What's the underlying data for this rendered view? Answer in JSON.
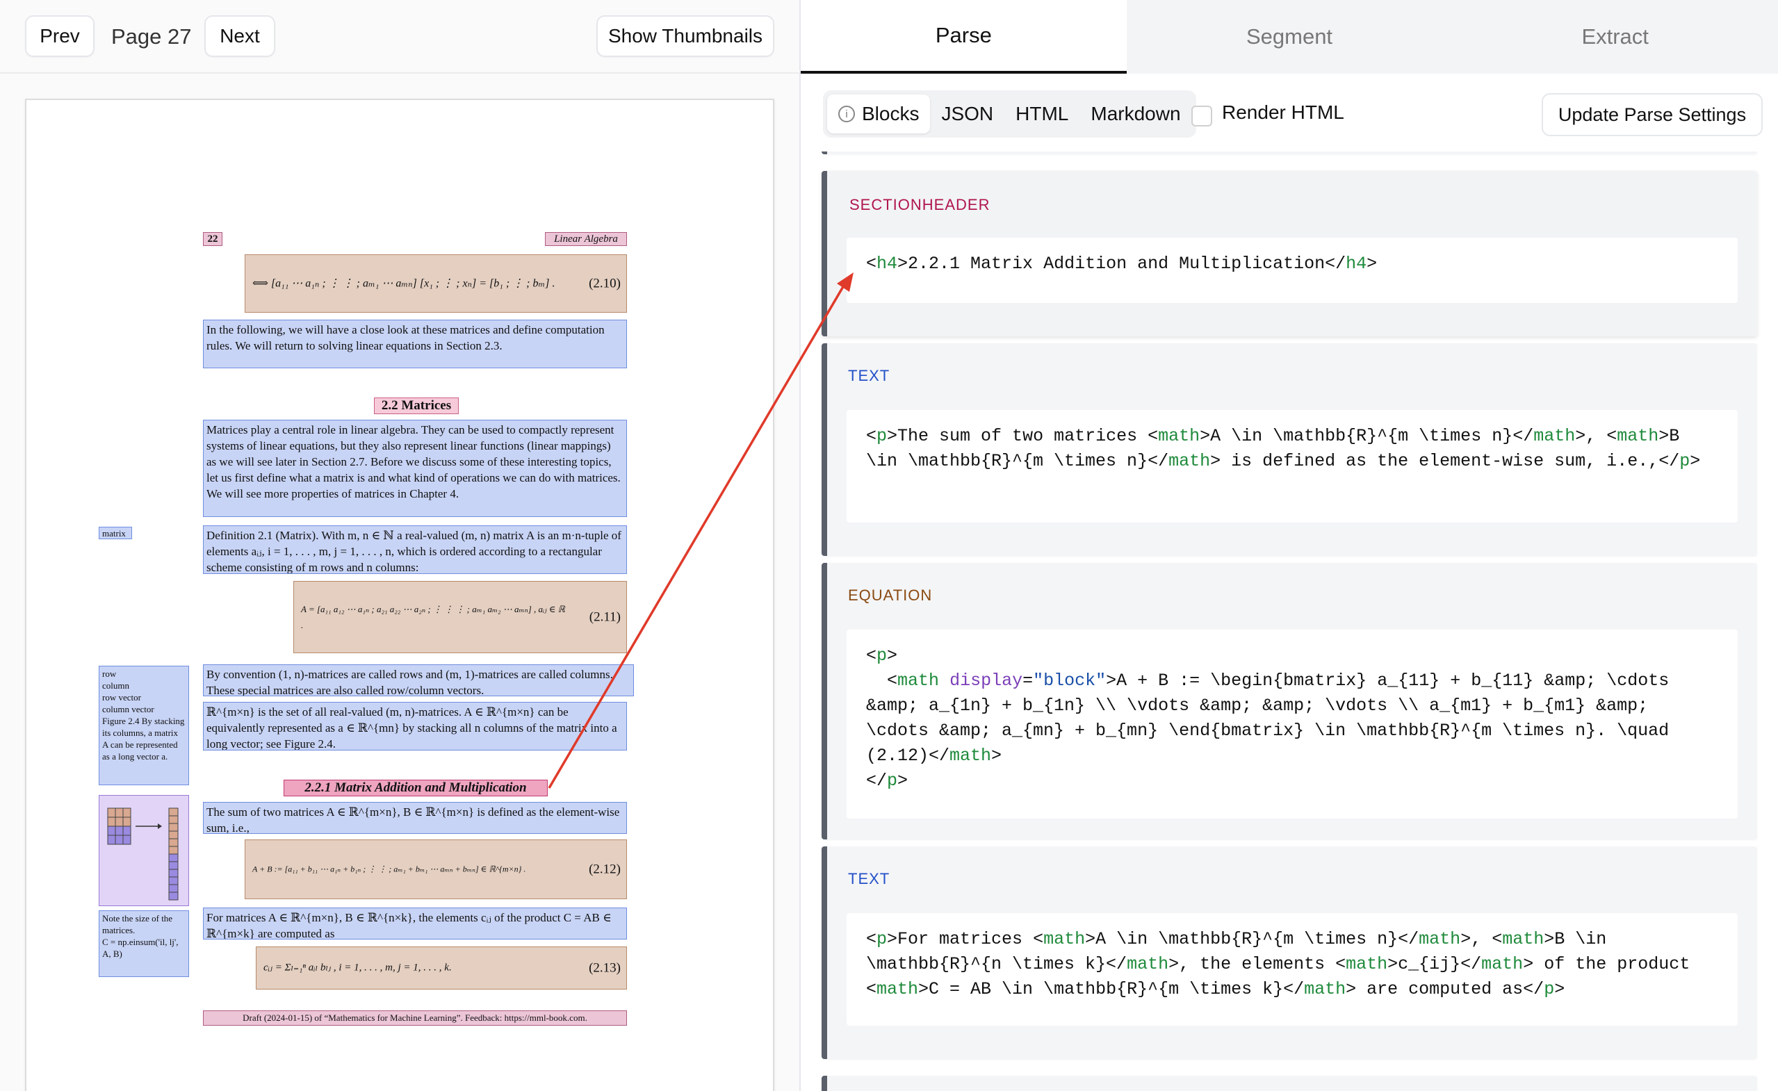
{
  "left": {
    "prev_label": "Prev",
    "page_label": "Page 27",
    "next_label": "Next",
    "thumbnails_label": "Show Thumbnails",
    "pdf": {
      "page_number": "22",
      "running_head": "Linear Algebra",
      "eq_2_10_body": "⟺ [a₁₁ ⋯ a₁ₙ ; ⋮ ⋮ ; aₘ₁ ⋯ aₘₙ] [x₁ ; ⋮ ; xₙ] = [b₁ ; ⋮ ; bₘ] .",
      "eq_2_10_num": "(2.10)",
      "intro_text": "In the following, we will have a close look at these matrices and define computation rules. We will return to solving linear equations in Section 2.3.",
      "section_title": "2.2 Matrices",
      "matrices_text": "Matrices play a central role in linear algebra. They can be used to compactly represent systems of linear equations, but they also represent linear functions (linear mappings) as we will see later in Section 2.7. Before we discuss some of these interesting topics, let us first define what a matrix is and what kind of operations we can do with matrices. We will see more properties of matrices in Chapter 4.",
      "margin_matrix": "matrix",
      "definition_text": "Definition 2.1 (Matrix). With m, n ∈ ℕ a real-valued (m, n) matrix A is an m·n-tuple of elements aᵢⱼ, i = 1, . . . , m, j = 1, . . . , n, which is ordered according to a rectangular scheme consisting of m rows and n columns:",
      "eq_2_11_body": "A = [a₁₁ a₁₂ ⋯ a₁ₙ ; a₂₁ a₂₂ ⋯ a₂ₙ ; ⋮ ⋮ ⋮ ; aₘ₁ aₘ₂ ⋯ aₘₙ] ,   aᵢⱼ ∈ ℝ .",
      "eq_2_11_num": "(2.11)",
      "margin_rows": "row\ncolumn\nrow vector\ncolumn vector\nFigure 2.4 By stacking its columns, a matrix A can be represented as a long vector a.",
      "convention_text": "By convention (1, n)-matrices are called rows and (m, 1)-matrices are called columns. These special matrices are also called row/column vectors.",
      "rmn_text": "ℝ^{m×n} is the set of all real-valued (m, n)-matrices. A ∈ ℝ^{m×n} can be equivalently represented as a ∈ ℝ^{mn} by stacking all n columns of the matrix into a long vector; see Figure 2.4.",
      "subsection_title": "2.2.1 Matrix Addition and Multiplication",
      "sum_text": "The sum of two matrices A ∈ ℝ^{m×n}, B ∈ ℝ^{m×n} is defined as the element-wise sum, i.e.,",
      "eq_2_12_body": "A + B := [a₁₁ + b₁₁ ⋯ a₁ₙ + b₁ₙ ; ⋮ ⋮ ; aₘ₁ + bₘ₁ ⋯ aₘₙ + bₘₙ] ∈ ℝ^{m×n} .",
      "eq_2_12_num": "(2.12)",
      "margin_note": "Note the size of the matrices.\nC = np.einsum('il, lj', A, B)",
      "product_text": "For matrices A ∈ ℝ^{m×n}, B ∈ ℝ^{n×k}, the elements cᵢⱼ of the product C = AB ∈ ℝ^{m×k} are computed as",
      "eq_2_13_body": "cᵢⱼ = Σₗ₌₁ⁿ aᵢₗ bₗⱼ ,      i = 1, . . . , m,     j = 1, . . . , k.",
      "eq_2_13_num": "(2.13)",
      "footer": "Draft (2024-01-15) of “Mathematics for Machine Learning”. Feedback: https://mml-book.com."
    }
  },
  "right": {
    "tabs": [
      {
        "label": "Parse",
        "active": true
      },
      {
        "label": "Segment",
        "active": false
      },
      {
        "label": "Extract",
        "active": false
      }
    ],
    "view_modes": [
      {
        "label": "Blocks",
        "active": true,
        "icon": "info-icon"
      },
      {
        "label": "JSON",
        "active": false
      },
      {
        "label": "HTML",
        "active": false
      },
      {
        "label": "Markdown",
        "active": false
      }
    ],
    "render_html_label": "Render HTML",
    "update_label": "Update Parse Settings",
    "blocks": [
      {
        "type": "SECTIONHEADER",
        "type_color": "#b0164e",
        "code": "<h4>2.2.1 Matrix Addition and Multiplication</h4>"
      },
      {
        "type": "TEXT",
        "type_color": "#2451c9",
        "code": "<p>The sum of two matrices <math>A \\in \\mathbb{R}^{m \\times n}</math>, <math>B \\in \\mathbb{R}^{m \\times n}</math> is defined as the element-wise sum, i.e.,</p>"
      },
      {
        "type": "EQUATION",
        "type_color": "#8a4a12",
        "code": "<p>\n  <math display=\"block\">A + B := \\begin{bmatrix} a_{11} + b_{11} &amp; \\cdots &amp; a_{1n} + b_{1n} \\\\ \\vdots &amp; &amp; \\vdots \\\\ a_{m1} + b_{m1} &amp; \\cdots &amp; a_{mn} + b_{mn} \\end{bmatrix} \\in \\mathbb{R}^{m \\times n}. \\quad (2.12)</math>\n</p>"
      },
      {
        "type": "TEXT",
        "type_color": "#2451c9",
        "code": "<p>For matrices <math>A \\in \\mathbb{R}^{m \\times n}</math>, <math>B \\in \\mathbb{R}^{n \\times k}</math>, the elements <math>c_{ij}</math> of the product <math>C = AB \\in \\mathbb{R}^{m \\times k}</math> are computed as</p>"
      }
    ],
    "arrow_color": "#e03a2a"
  }
}
